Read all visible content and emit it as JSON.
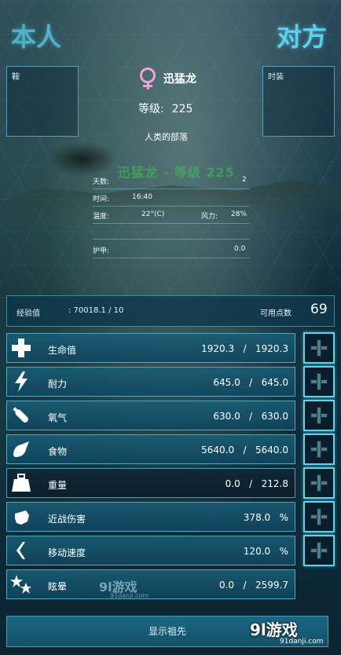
{
  "header": {
    "self_label": "本人",
    "other_label": "对方"
  },
  "equipment": {
    "left_label": "鞍",
    "right_label": "时装"
  },
  "creature": {
    "gender": "female",
    "name": "迅猛龙",
    "level_label": "等级:",
    "level_value": "225",
    "tribe": "人类的部落",
    "overlay_text": "迅猛龙 - 等级 225"
  },
  "info": {
    "days_label": "天数:",
    "days_value": "2",
    "time_label": "时间:",
    "time_value": "16:40",
    "temp_label": "温度:",
    "temp_value": "22°(C)",
    "wind_label": "风力:",
    "wind_value": "28%",
    "armor_label": "护甲:",
    "armor_value": "0.0"
  },
  "experience": {
    "label": "经验值",
    "value": ":  70018.1  /  10",
    "points_label": "可用点数",
    "points_value": "69"
  },
  "stats": [
    {
      "key": "health",
      "icon": "plus-icon",
      "name": "生命值",
      "value": "1920.3   /   1920.3"
    },
    {
      "key": "stamina",
      "icon": "lightning-icon",
      "name": "耐力",
      "value": "645.0   /   645.0"
    },
    {
      "key": "oxygen",
      "icon": "oxygen-tank-icon",
      "name": "氧气",
      "value": "630.0   /   630.0"
    },
    {
      "key": "food",
      "icon": "food-icon",
      "name": "食物",
      "value": "5640.0   /   5640.0"
    },
    {
      "key": "weight",
      "icon": "weight-icon",
      "name": "重量",
      "value": "0.0   /   212.8"
    },
    {
      "key": "melee",
      "icon": "fist-icon",
      "name": "近战伤害",
      "value": "378.0   %"
    },
    {
      "key": "speed",
      "icon": "boot-icon",
      "name": "移动速度",
      "value": "120.0   %"
    },
    {
      "key": "torpidity",
      "icon": "stars-icon",
      "name": "眩晕",
      "value": "0.0   /   2599.7"
    }
  ],
  "footer": {
    "ancestors_button": "显示祖先"
  },
  "watermark": {
    "brand": "9l游戏",
    "site": "91danji.com"
  },
  "colors": {
    "accent": "#5fd0ea",
    "gender_female": "#f2a0d8",
    "stat_bg": "#1a6a88"
  }
}
